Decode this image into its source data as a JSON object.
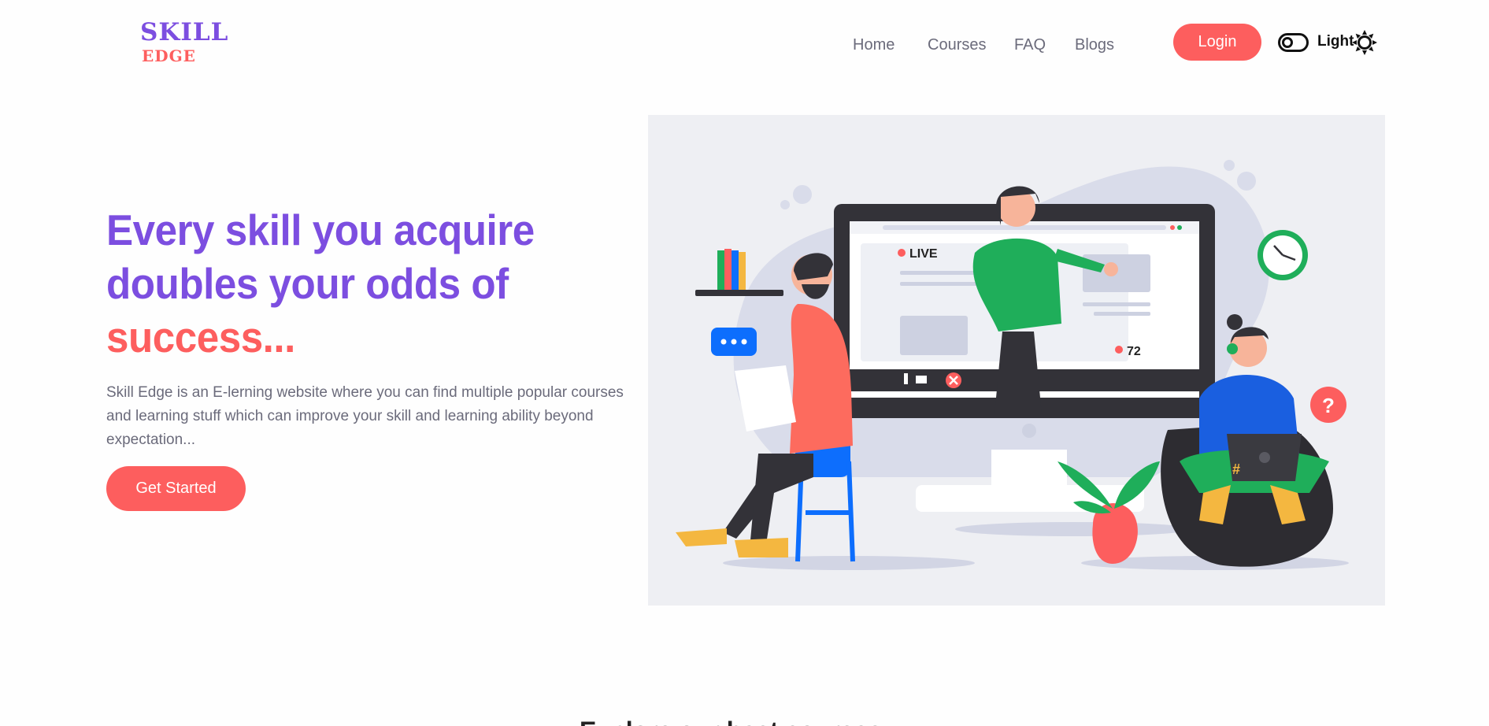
{
  "header": {
    "logo": {
      "top": "SKILL",
      "bottom": "EDGE"
    },
    "nav": [
      "Home",
      "Courses",
      "FAQ",
      "Blogs"
    ],
    "login_label": "Login",
    "theme_label": "Light"
  },
  "hero": {
    "title_line1": "Every skill you acquire",
    "title_line2": "doubles your odds of",
    "title_line3": "success...",
    "description": "Skill Edge is an E-lerning website where you can find multiple popular courses and learning stuff which can improve your skill and learning ability beyond expectation...",
    "cta_label": "Get Started"
  },
  "illustration": {
    "live_label": "LIVE",
    "viewer_count": "72"
  },
  "next_section": {
    "heading": "Explore our best courses"
  },
  "colors": {
    "brand_purple": "#7c4ee0",
    "brand_red": "#fd5e5e",
    "text_gray": "#6b6b7b",
    "illustration_bg": "#eeeff3"
  },
  "icons": [
    "toggle-icon",
    "sun-icon"
  ]
}
